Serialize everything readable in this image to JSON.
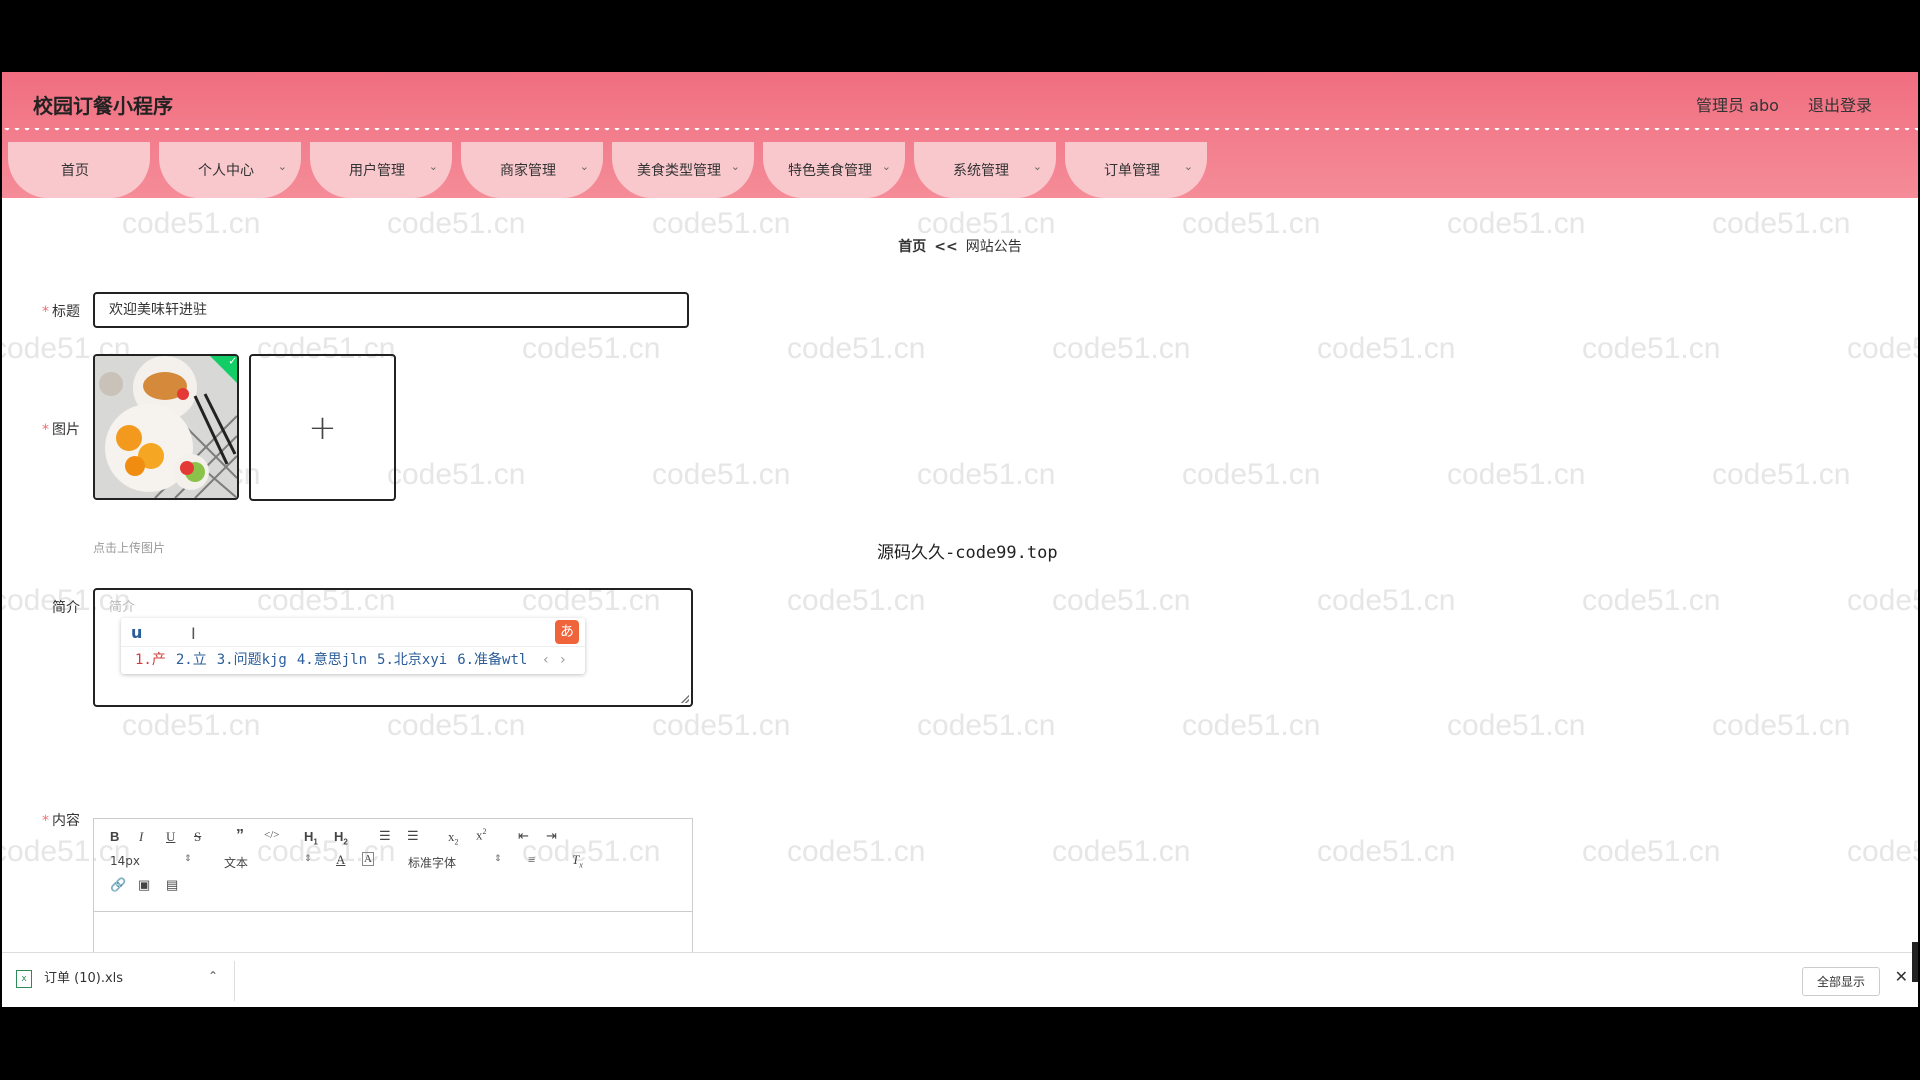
{
  "app": {
    "brand": "校园订餐小程序",
    "admin_label": "管理员 abo",
    "logout_label": "退出登录"
  },
  "nav": [
    {
      "label": "首页",
      "dropdown": false
    },
    {
      "label": "个人中心",
      "dropdown": true
    },
    {
      "label": "用户管理",
      "dropdown": true
    },
    {
      "label": "商家管理",
      "dropdown": true
    },
    {
      "label": "美食类型管理",
      "dropdown": true
    },
    {
      "label": "特色美食管理",
      "dropdown": true
    },
    {
      "label": "系统管理",
      "dropdown": true
    },
    {
      "label": "订单管理",
      "dropdown": true
    }
  ],
  "breadcrumb": {
    "home": "首页",
    "separator": "<<",
    "current": "网站公告"
  },
  "form": {
    "title_label": "标题",
    "title_value": "欢迎美味轩进驻",
    "image_label": "图片",
    "upload_tip": "点击上传图片",
    "intro_label": "简介",
    "intro_placeholder": "简介",
    "content_label": "内容"
  },
  "overlay_text": "源码久久-code99.top",
  "ime": {
    "typed": "u",
    "candidates": [
      "1.产",
      "2.立",
      "3.问题kjg",
      "4.意思jln",
      "5.北京xyi",
      "6.准备wtl"
    ],
    "pager": "‹ ›"
  },
  "editor_toolbar": {
    "font_size": "14px",
    "paragraph": "文本",
    "font_family": "标准字体"
  },
  "download_bar": {
    "file_name": "订单 (10).xls",
    "show_all": "全部显示"
  },
  "watermark": "code51.cn",
  "colors": {
    "header_top": "#f06e80",
    "nav_tab": "#f9c8cd",
    "required": "#f56c6c",
    "success": "#13ce66"
  }
}
